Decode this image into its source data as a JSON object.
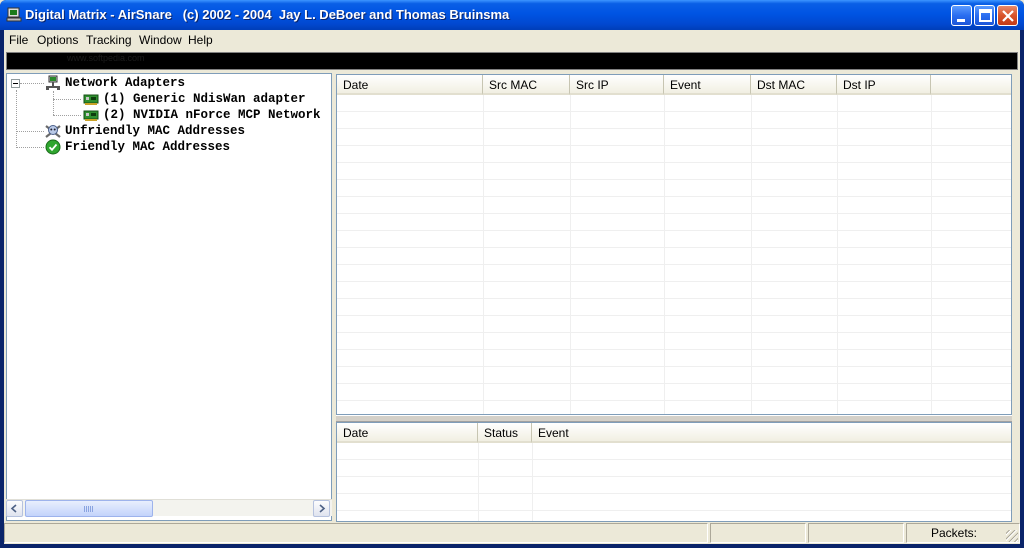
{
  "window": {
    "title": "Digital Matrix - AirSnare   (c) 2002 - 2004  Jay L. DeBoer and Thomas Bruinsma",
    "icon": "airsnare-app-icon"
  },
  "titlebar_buttons": {
    "minimize": "minimize-icon",
    "maximize": "maximize-icon",
    "close": "close-icon"
  },
  "menu": [
    "File",
    "Options",
    "Tracking",
    "Window",
    "Help"
  ],
  "blackbar": {
    "watermark": "www.softpedia.com"
  },
  "tree": {
    "root": {
      "label": "Network Adapters",
      "icon": "network-icon"
    },
    "adapters": [
      {
        "label": "(1) Generic NdisWan adapter",
        "icon": "network-card-icon"
      },
      {
        "label": "(2) NVIDIA nForce MCP Network",
        "icon": "network-card-icon"
      }
    ],
    "unfriendly": {
      "label": "Unfriendly MAC Addresses",
      "icon": "skull-crossbones-icon"
    },
    "friendly": {
      "label": "Friendly MAC Addresses",
      "icon": "check-circle-icon"
    }
  },
  "events_table": {
    "columns": [
      "Date",
      "Src MAC",
      "Src IP",
      "Event",
      "Dst MAC",
      "Dst IP",
      ""
    ]
  },
  "log_table": {
    "columns": [
      "Date",
      "Status",
      "Event"
    ]
  },
  "statusbar": {
    "packets_label": "Packets:"
  },
  "colors": {
    "titlebar": "#0054e3",
    "face": "#ece9d8",
    "blackbar": "#000000"
  }
}
